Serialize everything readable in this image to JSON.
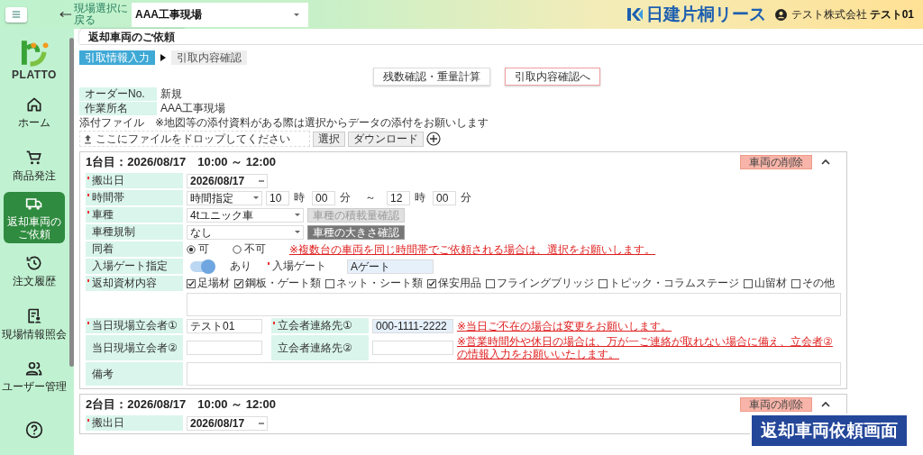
{
  "header": {
    "back_link": "現場選択に戻る",
    "site_select": {
      "value": "AAA工事現場"
    },
    "brand": "日建片桐リース",
    "company": "テスト株式会社",
    "user_name": "テスト01"
  },
  "sidebar": {
    "logo": "PLATTO",
    "items": [
      {
        "label": "ホーム",
        "selected": false
      },
      {
        "label": "商品発注",
        "selected": false
      },
      {
        "label": "返却車両のご依頼",
        "selected": true
      },
      {
        "label": "注文履歴",
        "selected": false
      },
      {
        "label": "現場情報照会",
        "selected": false
      },
      {
        "label": "ユーザー管理",
        "selected": false
      },
      {
        "selected": false
      }
    ]
  },
  "page_tab": "返却車両のご依頼",
  "steps": [
    {
      "label": "引取情報入力",
      "selected": true
    },
    {
      "label": "引取内容確認",
      "selected": false
    }
  ],
  "actions": [
    {
      "label": "残数確認・重量計算",
      "kind": "plain"
    },
    {
      "label": "引取内容確認へ",
      "kind": "primary"
    }
  ],
  "order_info": [
    {
      "label": "オーダーNo.",
      "value": "新規"
    },
    {
      "label": "作業所名",
      "value": "AAA工事現場"
    }
  ],
  "attachment": {
    "label": "添付ファイル",
    "note": "※地図等の添付資料がある際は選択からデータの添付をお願いします",
    "drop_hint": "ここにファイルをドロップしてください",
    "buttons": [
      "選択",
      "ダウンロード"
    ]
  },
  "vehicles": [
    {
      "title": "1台目：2026/08/17　10:00 ～ 12:00",
      "delete_label": "車両の削除",
      "expanded": true,
      "fields": [
        {
          "kind": "date",
          "label": "搬出日",
          "required": true,
          "value": "2026/08/17"
        },
        {
          "kind": "time",
          "label": "時間帯",
          "required": true,
          "mode": "時間指定",
          "start": [
            {
              "value": "10",
              "unit": "時"
            },
            {
              "value": "00",
              "unit": "分"
            }
          ],
          "separator": "～",
          "end": [
            {
              "value": "12",
              "unit": "時"
            },
            {
              "value": "00",
              "unit": "分"
            }
          ]
        },
        {
          "kind": "select_button",
          "label": "車種",
          "required": true,
          "value": "4tユニック車",
          "button": "車種の積載量確認",
          "button_disabled": true
        },
        {
          "kind": "select_button",
          "label": "車種規制",
          "required": false,
          "value": "なし",
          "button": "車種の大きさ確認",
          "button_disabled": false
        },
        {
          "kind": "radio",
          "label": "同着",
          "required": false,
          "options": [
            {
              "label": "可",
              "selected": true
            },
            {
              "label": "不可",
              "selected": false
            }
          ],
          "note": "※複数台の車両を同じ時間帯でご依頼される場合は、選択をお願いします。"
        },
        {
          "kind": "gate",
          "label": "入場ゲート指定",
          "required": false,
          "on": true,
          "state_text": "あり",
          "gate_label": "入場ゲート",
          "gate_required": true,
          "gate_value": "Aゲート"
        },
        {
          "kind": "checks",
          "label": "返却資材内容",
          "required": true,
          "options": [
            {
              "label": "足場材",
              "checked": true
            },
            {
              "label": "鋼板・ゲート類",
              "checked": true
            },
            {
              "label": "ネット・シート類",
              "checked": false
            },
            {
              "label": "保安用品",
              "checked": true
            },
            {
              "label": "フライングブリッジ",
              "checked": false
            },
            {
              "label": "トピック・コラムステージ",
              "checked": false
            },
            {
              "label": "山留材",
              "checked": false
            },
            {
              "label": "その他",
              "checked": false
            }
          ]
        },
        {
          "kind": "contact",
          "label": "当日現場立会者①",
          "required": true,
          "value": "テスト01",
          "contact_label": "立会者連絡先①",
          "contact_required": true,
          "contact_value": "000-1111-2222",
          "note": "※当日ご不在の場合は変更をお願いします。"
        },
        {
          "kind": "contact",
          "label": "当日現場立会者②",
          "required": false,
          "contact_label": "立会者連絡先②",
          "contact_required": false,
          "note": "※営業時間外や休日の場合は、万が一ご連絡が取れない場合に備え、立会者②の情報入力をお願いいたします。"
        },
        {
          "kind": "textarea",
          "label": "備考",
          "required": false
        }
      ]
    },
    {
      "title": "2台目：2026/08/17　10:00 ～ 12:00",
      "delete_label": "車両の削除",
      "expanded": true,
      "fields": [
        {
          "kind": "date",
          "label": "搬出日",
          "required": true,
          "value": "2026/08/17"
        }
      ]
    }
  ],
  "caption": "返却車両依頼画面"
}
